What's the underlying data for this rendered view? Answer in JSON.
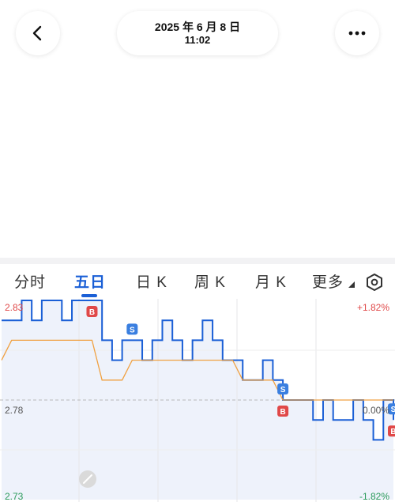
{
  "header": {
    "date": "2025 年 6 月 8 日",
    "time": "11:02",
    "back_icon": "chevron-left-icon",
    "more_icon": "ellipsis-icon"
  },
  "tabs": [
    {
      "label": "分时",
      "active": false
    },
    {
      "label": "五日",
      "active": true
    },
    {
      "label": "日 K",
      "active": false
    },
    {
      "label": "周 K",
      "active": false
    },
    {
      "label": "月 K",
      "active": false
    },
    {
      "label": "更多",
      "active": false
    }
  ],
  "tabs_settings_icon": "hexagon-settings-icon",
  "chart_data": {
    "type": "line",
    "title": "",
    "y_left_labels": [
      "2.83",
      "2.78",
      "2.73"
    ],
    "y_right_labels": [
      "+1.82%",
      "0.00%",
      "-1.82%"
    ],
    "ylim": [
      2.73,
      2.83
    ],
    "prev_close": 2.78,
    "days": 5,
    "series": [
      {
        "values": [
          2.82,
          2.82,
          2.83,
          2.82,
          2.83,
          2.83,
          2.82,
          2.83,
          2.83,
          2.83,
          2.81,
          2.8,
          2.81,
          2.81,
          2.8,
          2.81,
          2.82,
          2.81,
          2.8,
          2.81,
          2.82,
          2.81,
          2.8,
          2.8,
          2.79,
          2.79,
          2.8,
          2.79,
          2.78,
          2.78,
          2.78,
          2.77,
          2.78,
          2.77,
          2.77,
          2.78,
          2.77,
          2.76,
          2.78,
          2.77
        ]
      },
      {
        "values": [
          2.8,
          2.81,
          2.81,
          2.81,
          2.81,
          2.81,
          2.81,
          2.81,
          2.81,
          2.81,
          2.79,
          2.79,
          2.79,
          2.8,
          2.8,
          2.8,
          2.8,
          2.8,
          2.8,
          2.8,
          2.8,
          2.8,
          2.8,
          2.8,
          2.79,
          2.79,
          2.79,
          2.79,
          2.78,
          2.78,
          2.78,
          2.78,
          2.78,
          2.78,
          2.78,
          2.78,
          2.78,
          2.78,
          2.78,
          2.78
        ]
      }
    ],
    "markers": [
      {
        "label": "B",
        "color": "#e04848"
      },
      {
        "label": "S",
        "color": "#3a7fe0"
      },
      {
        "label": "S",
        "color": "#3a7fe0"
      },
      {
        "label": "B",
        "color": "#e04848"
      },
      {
        "label": "S",
        "color": "#3a7fe0"
      },
      {
        "label": "B",
        "color": "#e04848"
      }
    ],
    "colors": {
      "price": "#1a5fd6",
      "avg": "#f0a040",
      "up": "#e04848",
      "down": "#2a9a5a",
      "fill": "#eef2fb"
    }
  }
}
